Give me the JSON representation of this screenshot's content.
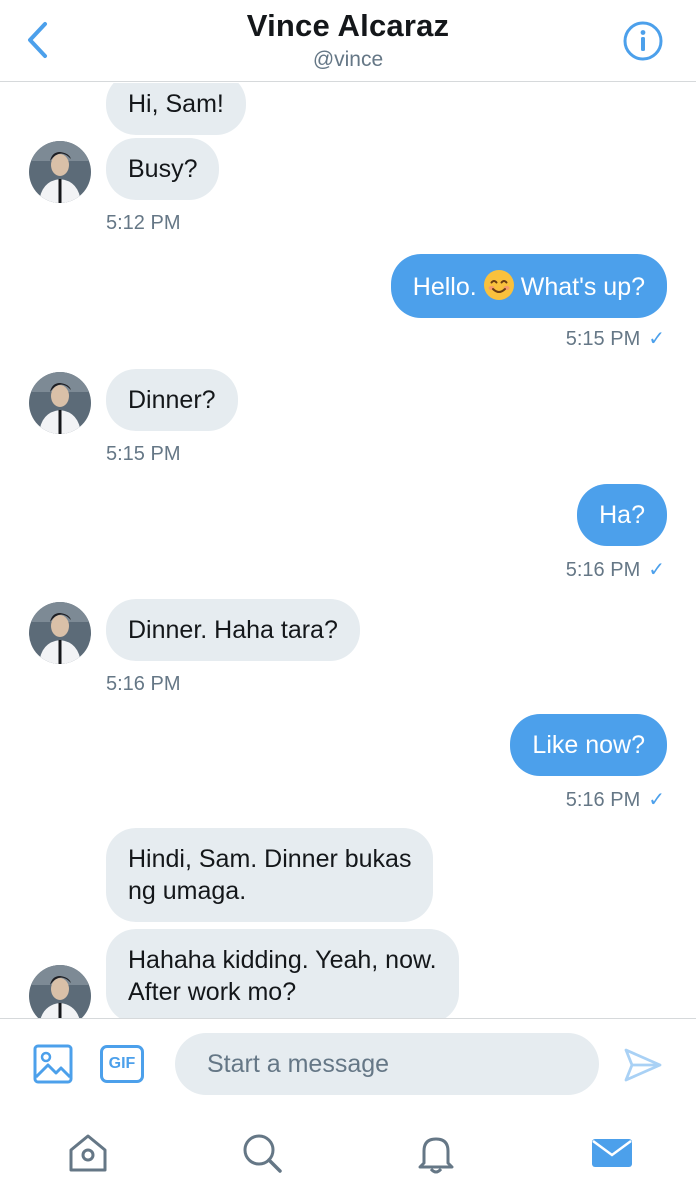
{
  "header": {
    "name": "Vince Alcaraz",
    "handle": "@vince"
  },
  "messages": [
    {
      "text": "Hi, Sam!"
    },
    {
      "text": "Busy?"
    },
    {
      "text": "5:12 PM"
    },
    {
      "text": "Hello.",
      "text2": "What's up?",
      "emoji": "smiling-face-emoji"
    },
    {
      "text": "5:15 PM",
      "check": "✓"
    },
    {
      "text": "Dinner?"
    },
    {
      "text": "5:15 PM"
    },
    {
      "text": "Ha?"
    },
    {
      "text": "5:16 PM",
      "check": "✓"
    },
    {
      "text": "Dinner. Haha tara?"
    },
    {
      "text": "5:16 PM"
    },
    {
      "text": "Like now?"
    },
    {
      "text": "5:16 PM",
      "check": "✓"
    },
    {
      "line1": "Hindi, Sam. Dinner bukas",
      "line2": "ng umaga."
    },
    {
      "line1": "Hahaha kidding. Yeah, now.",
      "line2": "After work mo?"
    }
  ],
  "composer": {
    "gif_label": "GIF",
    "placeholder": "Start a message"
  },
  "tabs": [
    "home-icon",
    "search-icon",
    "notifications-icon",
    "messages-icon"
  ],
  "colors": {
    "accent": "#4ca0eb",
    "incoming_bubble": "#e6ecf0",
    "muted_text": "#657786"
  }
}
